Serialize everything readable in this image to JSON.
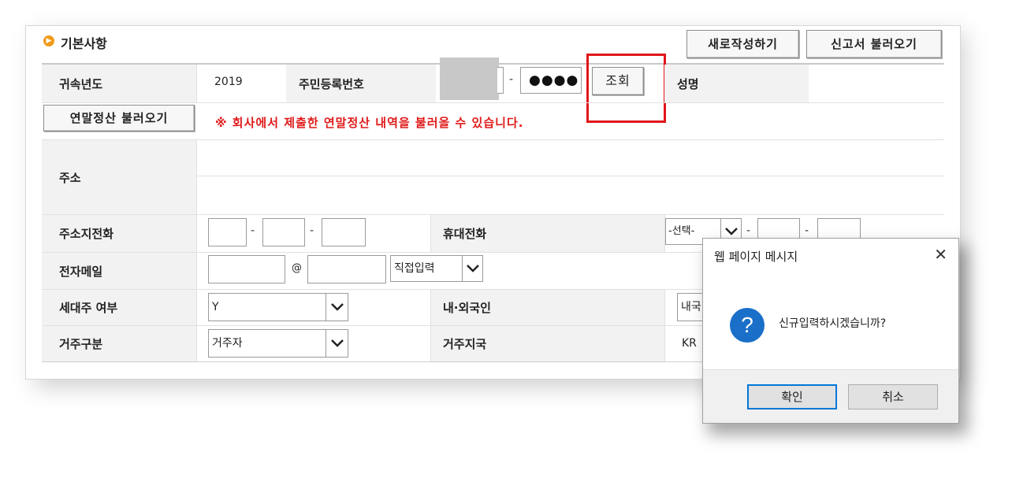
{
  "section": {
    "title": "기본사항"
  },
  "toolbar": {
    "new_label": "새로작성하기",
    "load_report_label": "신고서 불러오기"
  },
  "form": {
    "year_label": "귀속년도",
    "year_value": "2019",
    "rrn_label": "주민등록번호",
    "rrn_masked": "●●●●",
    "lookup_label": "조회",
    "name_label": "성명",
    "load_yearend_label": "연말정산 불러오기",
    "notice": "※ 회사에서 제출한 연말정산 내역을 불러올 수 있습니다.",
    "address_label": "주소",
    "home_phone_label": "주소지전화",
    "mobile_label": "휴대전화",
    "mobile_select": "-선택-",
    "email_label": "전자메일",
    "email_at": "@",
    "email_domain_select": "직접입력",
    "householder_label": "세대주 여부",
    "householder_value": "Y",
    "nationality_label": "내·외국인",
    "nationality_value": "내국",
    "residence_label": "거주구분",
    "residence_value": "거주자",
    "residence_country_label": "거주지국",
    "residence_country_value": "KR"
  },
  "dialog": {
    "title": "웹 페이지 메시지",
    "message": "신규입력하시겠습니까?",
    "ok_label": "확인",
    "cancel_label": "취소"
  },
  "colors": {
    "highlight": "#e0161a",
    "notice": "#e01a1a",
    "info_icon": "#1a6fc9",
    "bullet": "#f09a1a"
  }
}
